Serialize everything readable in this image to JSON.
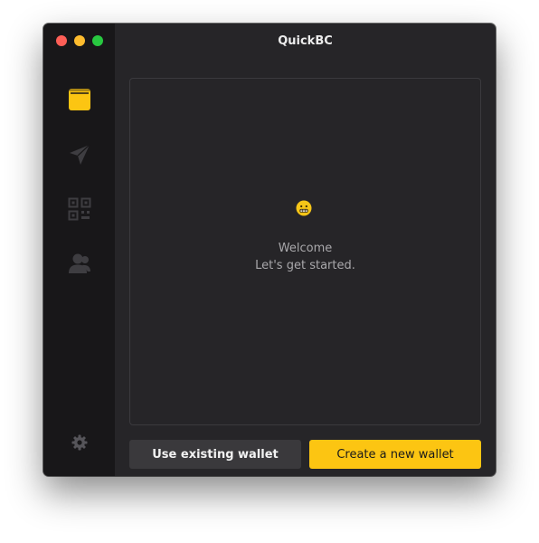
{
  "window": {
    "title": "QuickBC"
  },
  "sidebar": {
    "items": [
      {
        "icon": "wallet-icon",
        "active": true
      },
      {
        "icon": "send-icon",
        "active": false
      },
      {
        "icon": "qr-code-icon",
        "active": false
      },
      {
        "icon": "contacts-icon",
        "active": false
      }
    ],
    "settings_icon": "gear-icon"
  },
  "main": {
    "emoji": "grimacing-face-icon",
    "welcome_title": "Welcome",
    "welcome_subtitle": "Let's get started."
  },
  "actions": {
    "use_existing_label": "Use existing wallet",
    "create_new_label": "Create a new wallet"
  },
  "colors": {
    "accent": "#fcc512",
    "sidebar_bg": "#181719",
    "content_bg": "#262528",
    "secondary_button": "#3a393c",
    "inactive_icon": "#3e3d41"
  }
}
